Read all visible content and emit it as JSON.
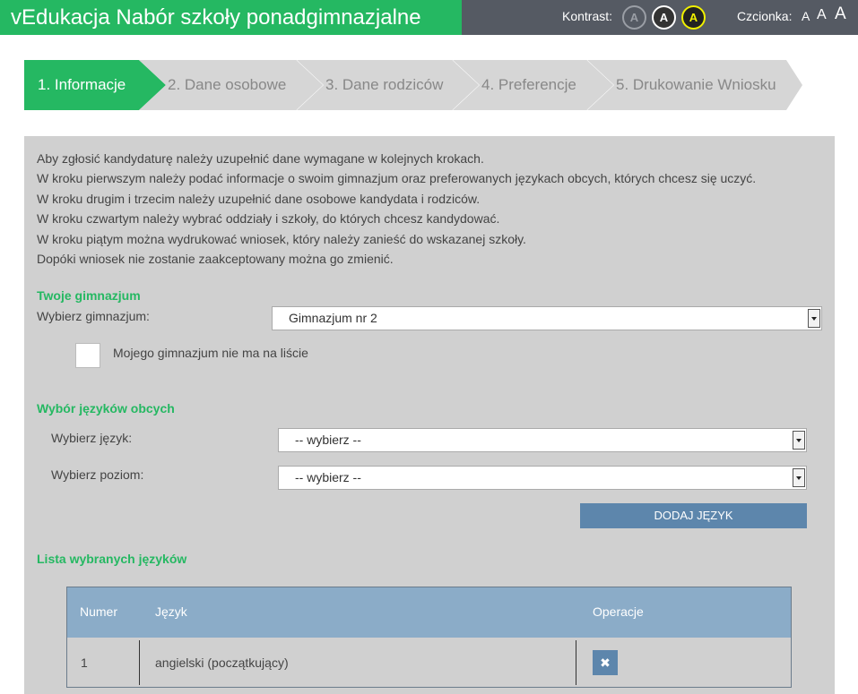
{
  "header": {
    "title": "vEdukacja Nabór szkoły ponadgimnazjalne",
    "contrast_label": "Kontrast:",
    "contrast_options": [
      "A",
      "A",
      "A"
    ],
    "font_label": "Czcionka:",
    "font_options": [
      "A",
      "A",
      "A"
    ]
  },
  "steps": [
    {
      "label": "1. Informacje",
      "active": true
    },
    {
      "label": "2. Dane osobowe",
      "active": false
    },
    {
      "label": "3. Dane rodziców",
      "active": false
    },
    {
      "label": "4. Preferencje",
      "active": false
    },
    {
      "label": "5. Drukowanie Wniosku",
      "active": false
    }
  ],
  "intro": [
    "Aby zgłosić kandydaturę należy uzupełnić dane wymagane w kolejnych krokach.",
    "W kroku pierwszym należy podać informacje o swoim gimnazjum oraz preferowanych językach obcych, których chcesz się uczyć.",
    "W kroku drugim i trzecim należy uzupełnić dane osobowe kandydata i rodziców.",
    "W kroku czwartym należy wybrać oddziały i szkoły, do których chcesz kandydować.",
    "W kroku piątym można wydrukować wniosek, który należy zanieść do wskazanej szkoły.",
    "Dopóki wniosek nie zostanie zaakceptowany można go zmienić."
  ],
  "school": {
    "section_title": "Twoje gimnazjum",
    "select_label": "Wybierz gimnazjum:",
    "selected": "Gimnazjum nr 2",
    "checkbox_label": "Mojego gimnazjum nie ma na liście"
  },
  "languages": {
    "section_title": "Wybór języków obcych",
    "language_label": "Wybierz język:",
    "language_selected": "-- wybierz --",
    "level_label": "Wybierz poziom:",
    "level_selected": "-- wybierz --",
    "add_button": "DODAJ JĘZYK"
  },
  "list": {
    "section_title": "Lista wybranych języków",
    "columns": [
      "Numer",
      "Język",
      "Operacje"
    ],
    "rows": [
      {
        "number": "1",
        "language": "angielski (początkujący)",
        "delete_glyph": "✖"
      }
    ]
  },
  "colors": {
    "brand_green": "#25b862",
    "header_gray": "#555a63",
    "panel_gray": "#d0d0d0",
    "button_blue": "#5d86ac",
    "table_head": "#8bacc8"
  }
}
